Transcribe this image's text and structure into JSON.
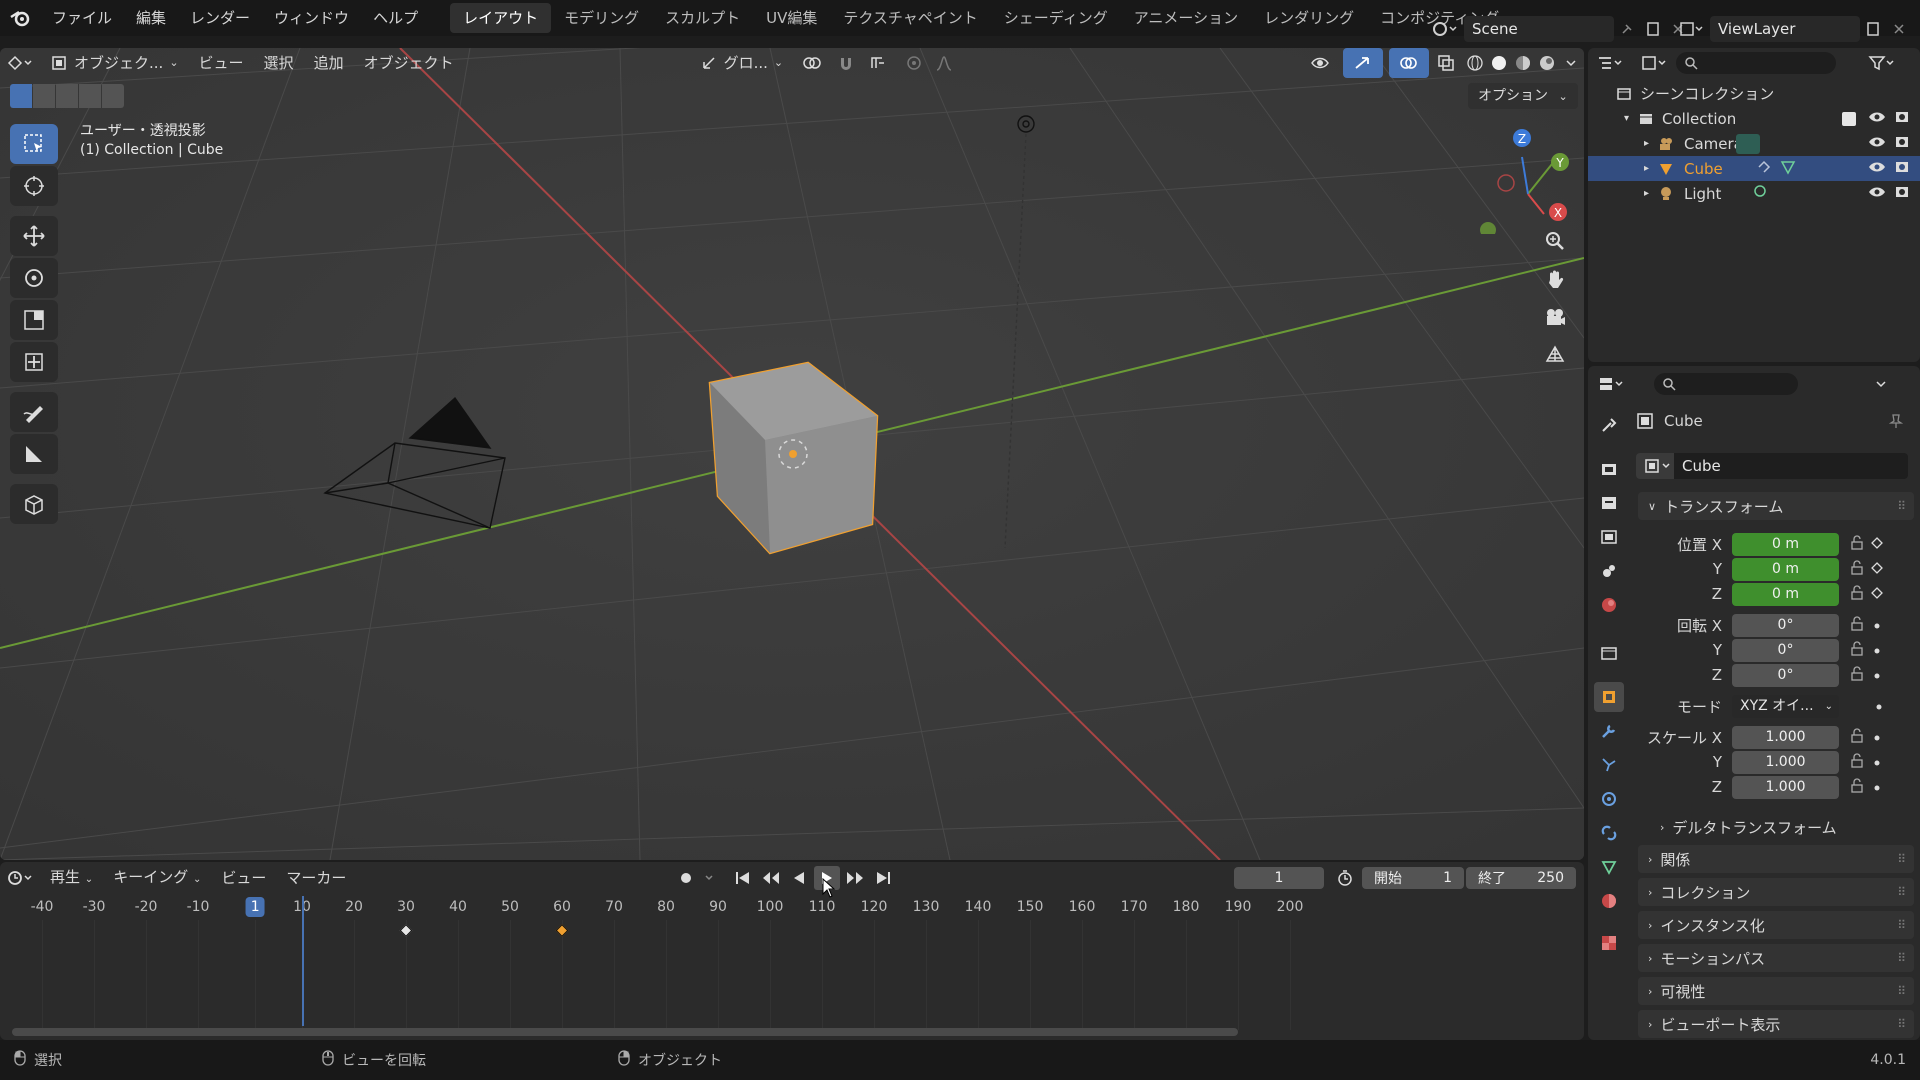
{
  "menu": {
    "items": [
      "ファイル",
      "編集",
      "レンダー",
      "ウィンドウ",
      "ヘルプ"
    ]
  },
  "workspaces": [
    "レイアウト",
    "モデリング",
    "スカルプト",
    "UV編集",
    "テクスチャペイント",
    "シェーディング",
    "アニメーション",
    "レンダリング",
    "コンポジティング"
  ],
  "scene": {
    "name": "Scene",
    "view_layer": "ViewLayer"
  },
  "viewport_header": {
    "mode": "オブジェク...",
    "menus": [
      "ビュー",
      "選択",
      "追加",
      "オブジェクト"
    ],
    "transform_orientation": "グロ...",
    "options": "オプション"
  },
  "viewport": {
    "view_name": "ユーザー・透視投影",
    "context": "(1) Collection | Cube",
    "gizmo_axes": [
      "X",
      "Y",
      "Z"
    ]
  },
  "outliner": {
    "root": "シーンコレクション",
    "collection": "Collection",
    "items": [
      {
        "label": "Camera",
        "icon": "camera-icon"
      },
      {
        "label": "Cube",
        "icon": "mesh-icon",
        "selected": true
      },
      {
        "label": "Light",
        "icon": "light-icon"
      }
    ]
  },
  "properties": {
    "object_name": "Cube",
    "name_field": "Cube",
    "transform_header": "トランスフォーム",
    "location": {
      "label": "位置 X",
      "x": "0 m",
      "y": "0 m",
      "z": "0 m"
    },
    "rotation": {
      "label": "回転 X",
      "x": "0°",
      "y": "0°",
      "z": "0°"
    },
    "mode": {
      "label": "モード",
      "value": "XYZ オイ..."
    },
    "scale": {
      "label": "スケール X",
      "x": "1.000",
      "y": "1.000",
      "z": "1.000"
    },
    "axis_labels": {
      "y": "Y",
      "z": "Z"
    },
    "delta_transform": "デルタトランスフォーム",
    "sections": [
      "関係",
      "コレクション",
      "インスタンス化",
      "モーションパス",
      "可視性",
      "ビューポート表示"
    ]
  },
  "timeline": {
    "menus": [
      "再生",
      "キーイング",
      "ビュー",
      "マーカー"
    ],
    "current_frame": "1",
    "start_label": "開始",
    "start": "1",
    "end_label": "終了",
    "end": "250",
    "ruler": [
      "-40",
      "-30",
      "-20",
      "-10",
      "1",
      "10",
      "20",
      "30",
      "40",
      "50",
      "60",
      "70",
      "80",
      "90",
      "100",
      "110",
      "120",
      "130",
      "140",
      "150",
      "160",
      "170",
      "180",
      "190",
      "200"
    ],
    "keyframes": [
      30,
      60
    ]
  },
  "status": {
    "select": "選択",
    "rotate_view": "ビューを回転",
    "object": "オブジェクト",
    "version": "4.0.1"
  },
  "colors": {
    "accent": "#4772b3",
    "selected_orange": "#f0a030",
    "x_axis": "#d94b4b",
    "y_axis": "#7ab33f",
    "location_green": "#3f8f2d"
  }
}
